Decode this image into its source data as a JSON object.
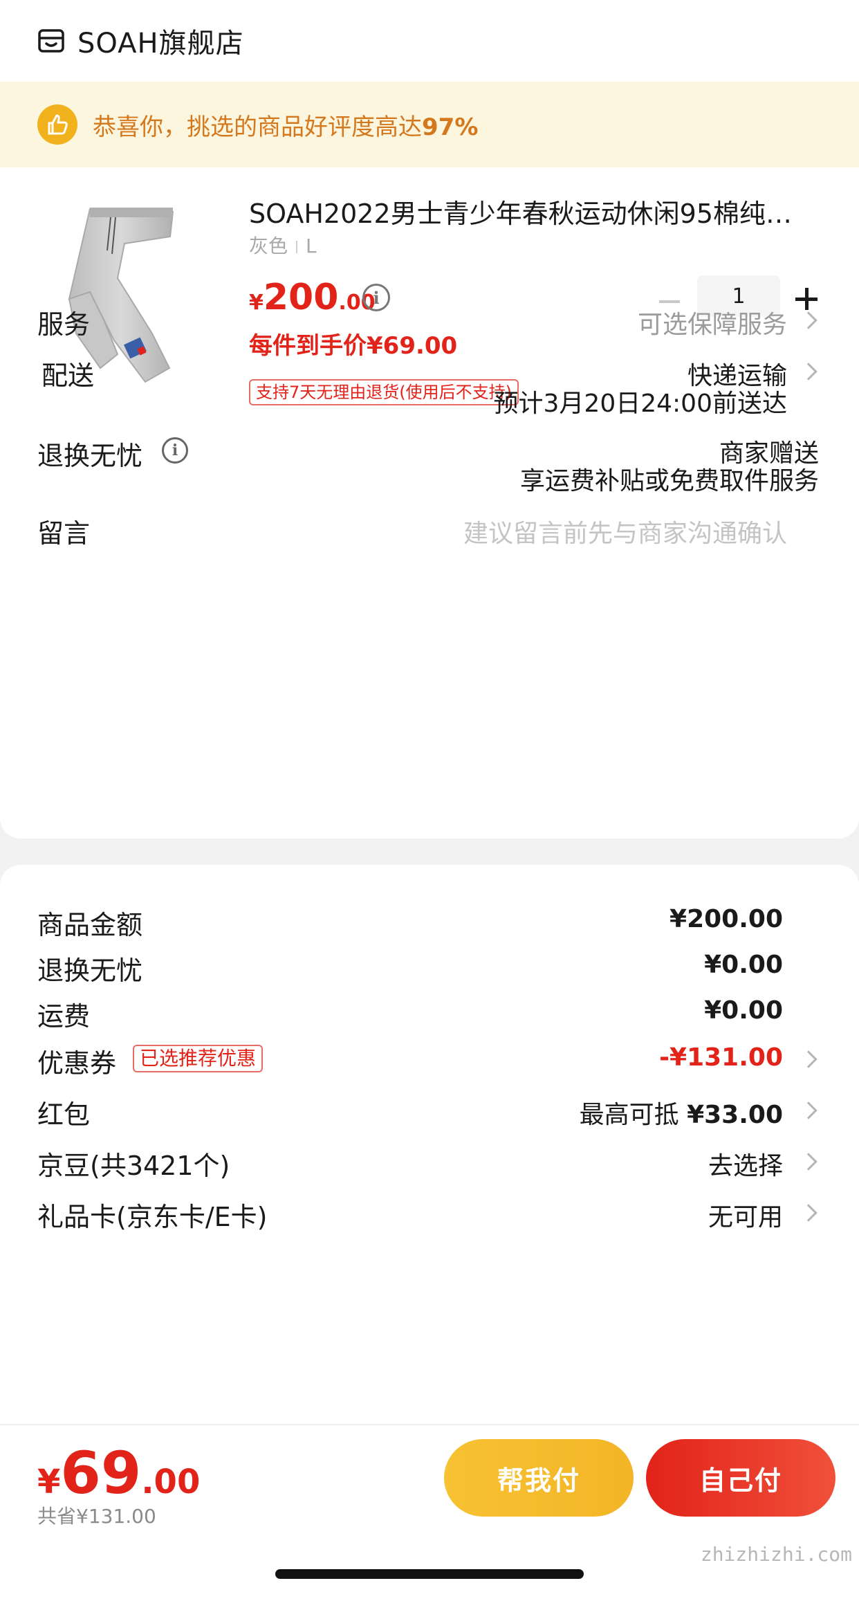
{
  "store": {
    "name": "SOAH旗舰店",
    "icon": "store-icon"
  },
  "banner": {
    "text": "恭喜你，挑选的商品好评度高达",
    "percent": "97%",
    "icon": "thumbs-up-icon"
  },
  "product": {
    "title": "SOAH2022男士青少年春秋运动休闲95棉纯…",
    "color": "灰色",
    "size": "L",
    "price_symbol": "¥",
    "price_int": "200",
    "price_dec": ".00",
    "unit_price": "每件到手价¥69.00",
    "return_tag": "支持7天无理由退货(使用后不支持)",
    "quantity": "1"
  },
  "rows": {
    "service": {
      "label": "服务",
      "value": "可选保障服务"
    },
    "delivery": {
      "label": "配送",
      "value": "快递运输",
      "eta": "预计3月20日24:00前送达"
    },
    "returns": {
      "label": "退换无忧",
      "value": "商家赠送",
      "detail": "享运费补贴或免费取件服务"
    },
    "message": {
      "label": "留言",
      "placeholder": "建议留言前先与商家沟通确认"
    }
  },
  "fees": {
    "goods": {
      "label": "商品金额",
      "value": "¥200.00"
    },
    "return_fee": {
      "label": "退换无忧",
      "value": "¥0.00"
    },
    "shipping": {
      "label": "运费",
      "value": "¥0.00"
    },
    "coupon": {
      "label": "优惠券",
      "tag": "已选推荐优惠",
      "value": "-¥131.00"
    },
    "redpacket": {
      "label": "红包",
      "value_prefix": "最高可抵",
      "value": "¥33.00"
    },
    "jd_beans": {
      "label": "京豆(共3421个)",
      "value": "去选择"
    },
    "gift_card": {
      "label": "礼品卡(京东卡/E卡)",
      "value": "无可用"
    }
  },
  "footer": {
    "total_symbol": "¥",
    "total_int": "69",
    "total_dec": ".00",
    "saved": "共省¥131.00",
    "help_pay": "帮我付",
    "self_pay": "自己付"
  },
  "watermark": "zhizhizhi.com",
  "colors": {
    "accent_red": "#e2231a",
    "banner_bg": "#fdf6df",
    "banner_text": "#d4781e",
    "help_btn": "#f5bd2c"
  }
}
